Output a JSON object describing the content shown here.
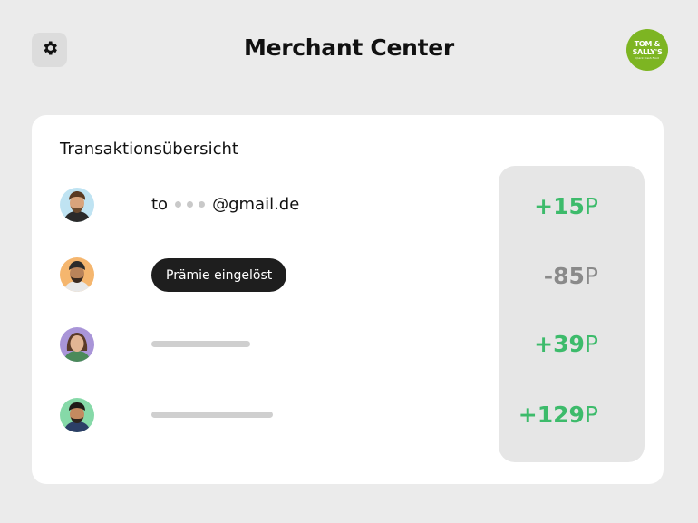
{
  "header": {
    "title": "Merchant Center",
    "logo": {
      "line1": "TOM &",
      "line2": "SALLY'S",
      "line3": "Quick Fresh Food"
    }
  },
  "card": {
    "title": "Transaktionsübersicht",
    "rows": [
      {
        "type": "email",
        "prefix": "to",
        "suffix": "@gmail.de",
        "points": "+15",
        "unit": "P",
        "status": "positive"
      },
      {
        "type": "badge",
        "badge_label": "Prämie eingelöst",
        "points": "-85",
        "unit": "P",
        "status": "negative"
      },
      {
        "type": "placeholder",
        "points": "+39",
        "unit": "P",
        "status": "positive"
      },
      {
        "type": "placeholder",
        "points": "+129",
        "unit": "P",
        "status": "positive"
      }
    ]
  },
  "icons": {
    "settings": "gear-icon"
  },
  "colors": {
    "background": "#ebebeb",
    "card": "#ffffff",
    "positive": "#3dbb6b",
    "negative": "#8a8a8a",
    "badge": "#1e1e1e",
    "logo": "#7db522"
  }
}
